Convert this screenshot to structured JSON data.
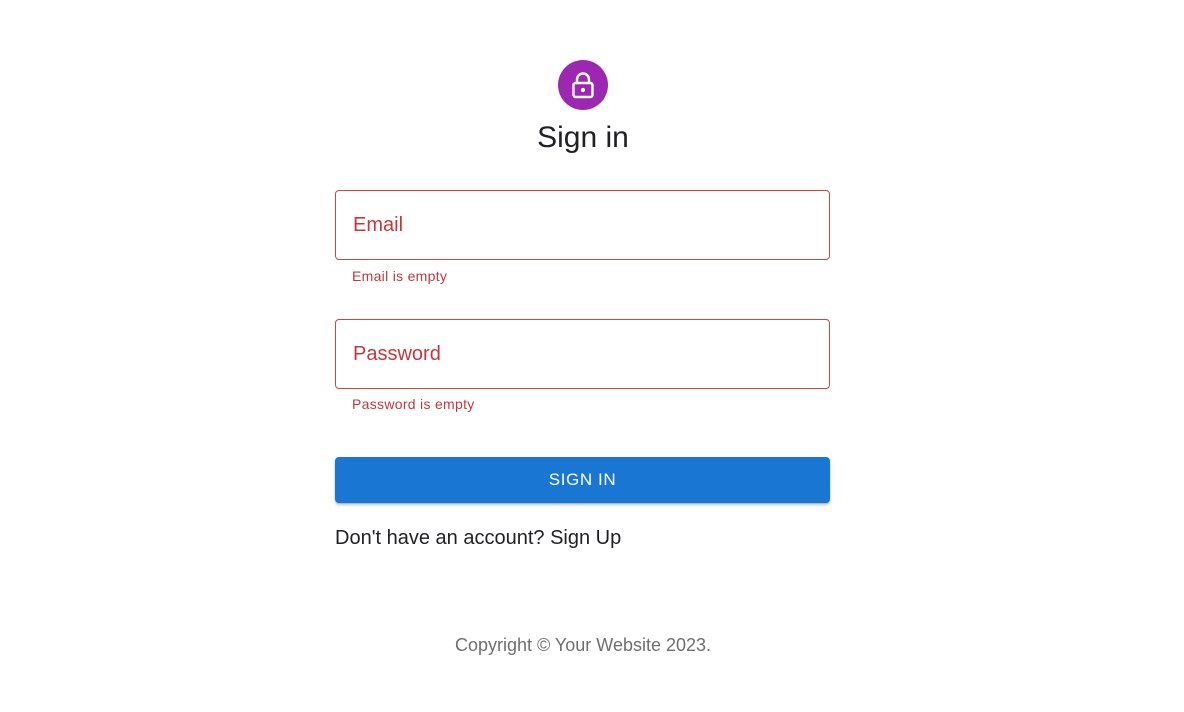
{
  "header": {
    "icon": "lock-icon",
    "avatar_color": "#9c27b0",
    "title": "Sign in"
  },
  "form": {
    "email": {
      "label": "Email",
      "value": "",
      "error": "Email is empty"
    },
    "password": {
      "label": "Password",
      "value": "",
      "error": "Password is empty"
    },
    "error_color": "#c0393b",
    "submit_label": "SIGN IN",
    "submit_color": "#1976d2"
  },
  "links": {
    "signup": "Don't have an account? Sign Up"
  },
  "footer": {
    "copyright": "Copyright © Your Website 2023."
  }
}
